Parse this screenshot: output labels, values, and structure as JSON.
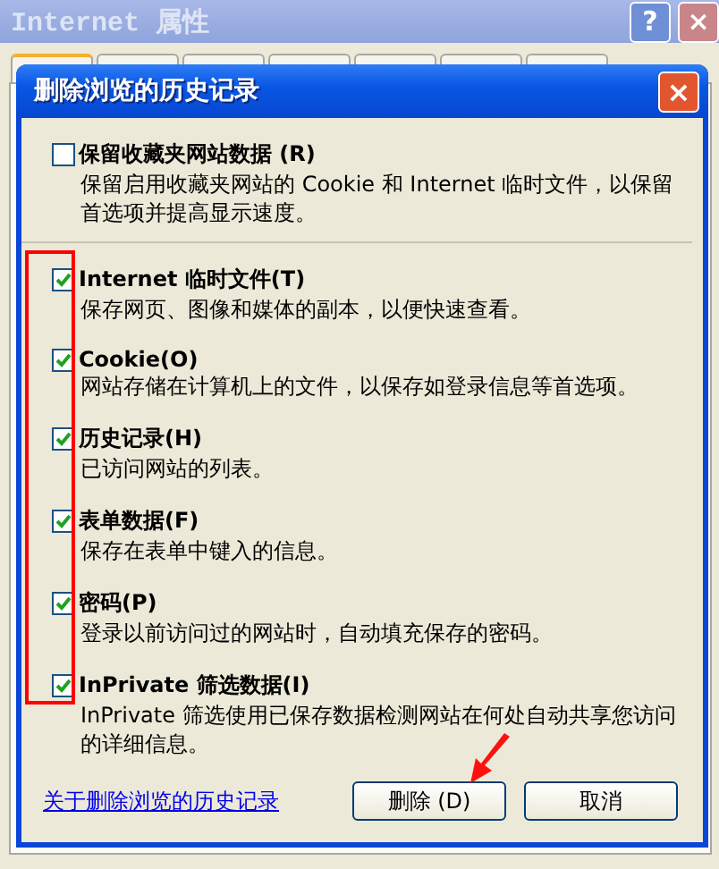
{
  "window": {
    "title": "Internet 属性",
    "help_button": "?",
    "close_button": "×"
  },
  "tabs": [
    {
      "selected": true
    },
    {
      "selected": false
    },
    {
      "selected": false
    },
    {
      "selected": false
    },
    {
      "selected": false
    },
    {
      "selected": false
    },
    {
      "selected": false
    }
  ],
  "dialog": {
    "title": "删除浏览的历史记录",
    "close_button": "×"
  },
  "options": [
    {
      "label": "保留收藏夹网站数据 (R)",
      "description": "保留启用收藏夹网站的 Cookie 和 Internet 临时文件，以保留首选项并提高显示速度。",
      "checked": false
    },
    {
      "label": "Internet 临时文件(T)",
      "description": "保存网页、图像和媒体的副本，以便快速查看。",
      "checked": true
    },
    {
      "label": "Cookie(O)",
      "description": "网站存储在计算机上的文件，以保存如登录信息等首选项。",
      "checked": true
    },
    {
      "label": "历史记录(H)",
      "description": "已访问网站的列表。",
      "checked": true
    },
    {
      "label": "表单数据(F)",
      "description": "保存在表单中键入的信息。",
      "checked": true
    },
    {
      "label": "密码(P)",
      "description": "登录以前访问过的网站时，自动填充保存的密码。",
      "checked": true
    },
    {
      "label": "InPrivate 筛选数据(I)",
      "description": "InPrivate 筛选使用已保存数据检测网站在何处自动共享您访问的详细信息。",
      "checked": true
    }
  ],
  "link": "关于删除浏览的历史记录",
  "buttons": [
    "删除 (D)",
    "取消"
  ]
}
